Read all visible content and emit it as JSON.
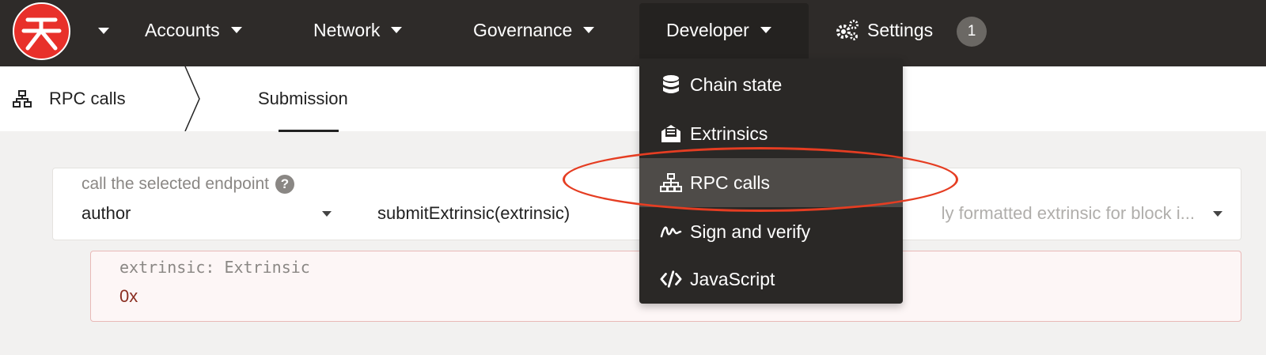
{
  "topnav": {
    "items": [
      {
        "label": "Accounts"
      },
      {
        "label": "Network"
      },
      {
        "label": "Governance"
      },
      {
        "label": "Developer"
      },
      {
        "label": "Settings"
      }
    ],
    "settings_badge": "1"
  },
  "subnav": {
    "title": "RPC calls",
    "tabs": [
      {
        "label": "Submission"
      }
    ]
  },
  "call": {
    "label": "call the selected endpoint",
    "section_value": "author",
    "method_value": "submitExtrinsic(extrinsic)",
    "description": "ly formatted extrinsic for block i..."
  },
  "param": {
    "label": "extrinsic: Extrinsic",
    "value": "0x"
  },
  "developer_menu": {
    "items": [
      {
        "label": "Chain state",
        "icon": "database-icon"
      },
      {
        "label": "Extrinsics",
        "icon": "envelope-icon"
      },
      {
        "label": "RPC calls",
        "icon": "network-icon",
        "active": true
      },
      {
        "label": "Sign and verify",
        "icon": "signature-icon"
      },
      {
        "label": "JavaScript",
        "icon": "code-icon"
      }
    ]
  },
  "colors": {
    "topbar": "#2e2b29",
    "logo": "#e8302a",
    "annotation": "#e53d22",
    "param_value": "#8b2f22"
  }
}
